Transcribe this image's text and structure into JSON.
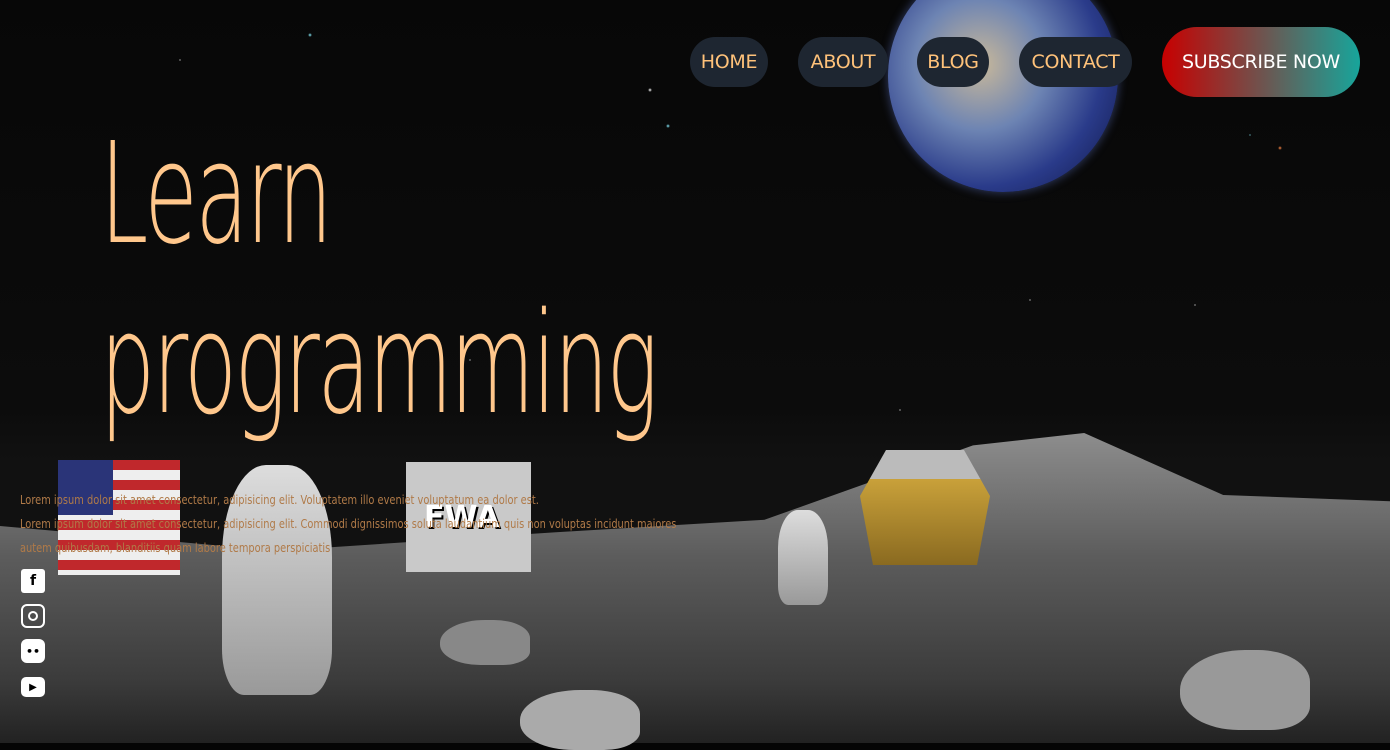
{
  "nav": {
    "items": [
      {
        "label": "HOME"
      },
      {
        "label": "ABOUT"
      },
      {
        "label": "BLOG"
      },
      {
        "label": "CONTACT"
      }
    ],
    "subscribe_label": "SUBSCRIBE NOW"
  },
  "hero": {
    "title_line1": "Learn",
    "title_line2": "programming",
    "paragraph1": "Lorem ipsum dolor sit amet consectetur, adipisicing elit. Voluptatem illo eveniet voluptatum ea dolor est.",
    "paragraph2": "Lorem ipsum dolor sit amet consectetur, adipisicing elit. Commodi dignissimos soluta laudantium quis non voluptas incidunt maiores autem quibusdam, blanditiis quam labore tempora perspiciatis"
  },
  "social": [
    {
      "icon": "facebook-icon"
    },
    {
      "icon": "instagram-icon"
    },
    {
      "icon": "discord-icon"
    },
    {
      "icon": "youtube-icon"
    }
  ],
  "background": {
    "flag_logo": "FWA"
  },
  "colors": {
    "accent": "#ffc78c",
    "nav_bg": "#1e2631",
    "subscribe_start": "#c80000",
    "subscribe_end": "#17a59b"
  }
}
